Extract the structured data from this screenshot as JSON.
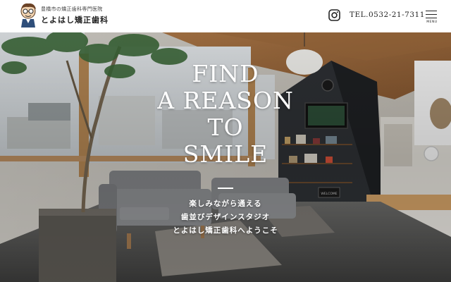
{
  "header": {
    "logo_sub": "豊橋市の矯正歯科専門医院",
    "logo_main": "とよはし矯正歯科",
    "logo_icon": "mascot-logo-icon",
    "instagram_icon": "instagram-icon",
    "tel": "TEL.0532-21-7311",
    "menu_label": "MENU"
  },
  "hero": {
    "headline": [
      "FIND",
      "A REASON",
      "TO",
      "SMILE"
    ],
    "tagline": [
      "楽しみながら通える",
      "歯並びデザインスタジオ",
      "とよはし矯正歯科へようこそ"
    ],
    "sign_text": "WELCOME"
  },
  "colors": {
    "header_bg": "#ffffff",
    "text_dark": "#222222",
    "hero_text": "#ffffff"
  }
}
